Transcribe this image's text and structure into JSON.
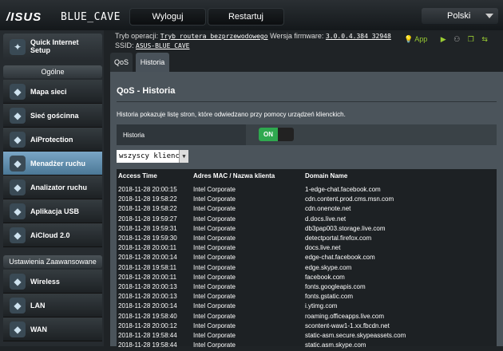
{
  "header": {
    "logo": "/ISUS",
    "model": "BLUE_CAVE",
    "logout_label": "Wyloguj",
    "restart_label": "Restartuj",
    "language": "Polski"
  },
  "info": {
    "mode_label": "Tryb operacji:",
    "mode_value": "Tryb routera bezprzewodowego",
    "firmware_label": "Wersja firmware:",
    "firmware_value": "3.0.0.4.384_32948",
    "ssid_label": "SSID:",
    "ssid_value": "ASUS-BLUE_CAVE",
    "app_label": "App"
  },
  "sidebar": {
    "qis_label": "Quick Internet Setup",
    "general_header": "Ogólne",
    "advanced_header": "Ustawienia Zaawansowane",
    "general_items": [
      {
        "label": "Mapa sieci",
        "icon": "network-map-icon"
      },
      {
        "label": "Sieć gościnna",
        "icon": "guest-network-icon"
      },
      {
        "label": "AiProtection",
        "icon": "shield-icon"
      },
      {
        "label": "Menadżer ruchu",
        "icon": "traffic-manager-icon",
        "active": true
      },
      {
        "label": "Analizator ruchu",
        "icon": "traffic-analyzer-icon"
      },
      {
        "label": "Aplikacja USB",
        "icon": "usb-icon"
      },
      {
        "label": "AiCloud 2.0",
        "icon": "cloud-icon"
      }
    ],
    "advanced_items": [
      {
        "label": "Wireless",
        "icon": "wireless-icon"
      },
      {
        "label": "LAN",
        "icon": "lan-icon"
      },
      {
        "label": "WAN",
        "icon": "globe-icon"
      }
    ]
  },
  "tabs": [
    "QoS",
    "Historia"
  ],
  "panel": {
    "title": "QoS - Historia",
    "description": "Historia pokazuje listę stron, które odwiedzano przy pomocy urządzeń klienckich.",
    "history_label": "Historia",
    "toggle_label": "ON",
    "client_filter": "wszyscy klienci"
  },
  "table": {
    "headers": [
      "Access Time",
      "Adres MAC / Nazwa klienta",
      "Domain Name"
    ],
    "rows": [
      [
        "2018-11-28  20:00:15",
        "Intel Corporate",
        "1-edge-chat.facebook.com"
      ],
      [
        "2018-11-28  19:58:22",
        "Intel Corporate",
        "cdn.content.prod.cms.msn.com"
      ],
      [
        "2018-11-28  19:58:22",
        "Intel Corporate",
        "cdn.onenote.net"
      ],
      [
        "2018-11-28  19:59:27",
        "Intel Corporate",
        "d.docs.live.net"
      ],
      [
        "2018-11-28  19:59:31",
        "Intel Corporate",
        "db3pap003.storage.live.com"
      ],
      [
        "2018-11-28  19:59:30",
        "Intel Corporate",
        "detectportal.firefox.com"
      ],
      [
        "2018-11-28  20:00:11",
        "Intel Corporate",
        "docs.live.net"
      ],
      [
        "2018-11-28  20:00:14",
        "Intel Corporate",
        "edge-chat.facebook.com"
      ],
      [
        "2018-11-28  19:58:11",
        "Intel Corporate",
        "edge.skype.com"
      ],
      [
        "2018-11-28  20:00:11",
        "Intel Corporate",
        "facebook.com"
      ],
      [
        "2018-11-28  20:00:13",
        "Intel Corporate",
        "fonts.googleapis.com"
      ],
      [
        "2018-11-28  20:00:13",
        "Intel Corporate",
        "fonts.gstatic.com"
      ],
      [
        "2018-11-28  20:00:14",
        "Intel Corporate",
        "i.ytimg.com"
      ],
      [
        "2018-11-28  19:58:40",
        "Intel Corporate",
        "roaming.officeapps.live.com"
      ],
      [
        "2018-11-28  20:00:12",
        "Intel Corporate",
        "scontent-waw1-1.xx.fbcdn.net"
      ],
      [
        "2018-11-28  19:58:44",
        "Intel Corporate",
        "static-asm.secure.skypeassets.com"
      ],
      [
        "2018-11-28  19:58:44",
        "Intel Corporate",
        "static.asm.skype.com"
      ]
    ]
  },
  "colors": {
    "accent": "#2fa84f",
    "active_nav": "#5f8fb0",
    "app_green": "#99cc33"
  }
}
